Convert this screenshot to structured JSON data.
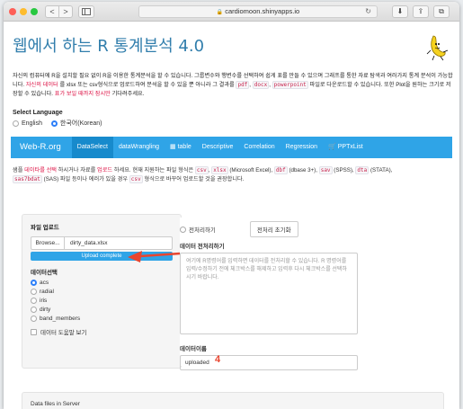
{
  "browser": {
    "url": "cardiomoon.shinyapps.io",
    "back_glyph": "<",
    "forward_glyph": ">",
    "reload_glyph": "↻",
    "download_glyph": "⬇",
    "share_glyph": "⇪",
    "tabs_glyph": "⧉"
  },
  "page": {
    "title": "웹에서 하는 R 통계분석 4.0",
    "desc_1": "자신의 컴퓨터에 R을 설치할 필요 없이 R을 이용한 통계분석을 할 수 있습니다. 그룹변수와 행변수를 선택하여 쉽게 표를 만들 수 있으며 그래프를 통한 자료 탐색과 여러가지 통계 분석이 가능합니다.",
    "desc_hl_1": "자신의 데이터",
    "desc_2": "를 xlsx 또는 csv형식으로 업로드하여 분석을 할 수 있을 뿐 아니라 그 결과를",
    "desc_code_pdf": "pdf",
    "desc_code_docx": "docx",
    "desc_code_pptx": "powerpoint",
    "desc_3": "파일로 다운로드할 수 있습니다. 또한 Plot을 원하는 크기로 저장할 수 있습니다.",
    "desc_hl_2": "표가 보일 때까지 잠시만",
    "desc_4": "기다려주세요."
  },
  "language": {
    "title": "Select Language",
    "options": [
      "English",
      "한국어(Korean)"
    ],
    "selected": "한국어(Korean)"
  },
  "navbar": {
    "brand": "Web-R.org",
    "items": [
      "DataSelect",
      "dataWrangling",
      "▦ table",
      "Descriptive",
      "Correlation",
      "Regression",
      "🛒 PPTxList"
    ],
    "active": "DataSelect"
  },
  "notice": {
    "a": "샘플",
    "hl_1": "데이타를 선택",
    "b": "하시거나 자료를",
    "hl_2": "업로드",
    "c": "하세요. 현재 지원하는 파일 형식은",
    "code_csv": "csv",
    "code_xlsx": "xlsx",
    "d": "(Microsoft Excel),",
    "code_dbf": "dbf",
    "e": "(dbase 3+),",
    "code_sav": "sav",
    "f": "(SPSS),",
    "code_dta": "dta",
    "g": "(STATA),",
    "code_sas": "sas7bdat",
    "h": "(SAS) 파일 등이나 에러가 있을 경우",
    "code_csv2": "csv",
    "i": "형식으로 바꾸어 업로드할 것을 권장합니다."
  },
  "sidebar": {
    "upload_label": "파일 업로드",
    "browse_label": "Browse...",
    "file_name": "dirty_data.xlsx",
    "progress_text": "Upload complete",
    "progress": 1.0,
    "dataset_label": "데이터선택",
    "datasets": [
      "acs",
      "radial",
      "iris",
      "dirty",
      "band_members"
    ],
    "selected_dataset": "acs",
    "help_label": "데이터 도움말 보기"
  },
  "main": {
    "preprocess_label": "전처리하기",
    "reset_label": "전처리 초기화",
    "textarea_label": "데이터 전처리하기",
    "textarea_placeholder": "여기에 R명령어를 입력하면 데이터를 전처리할 수 있습니다. R 명령어를 입력/수정하기 전에 체크박스를 해제하고 입력후 다시 체크박스를 선택하시기 바랍니다.",
    "dataname_label": "데이터이름",
    "dataname_value": "uploaded",
    "annotation_number": "4"
  },
  "bottom": {
    "label": "Data files in Server"
  },
  "colors": {
    "brand": "#2fa4e7",
    "title": "#317eac",
    "highlight": "#dd1144",
    "annotation": "#e8452f"
  }
}
